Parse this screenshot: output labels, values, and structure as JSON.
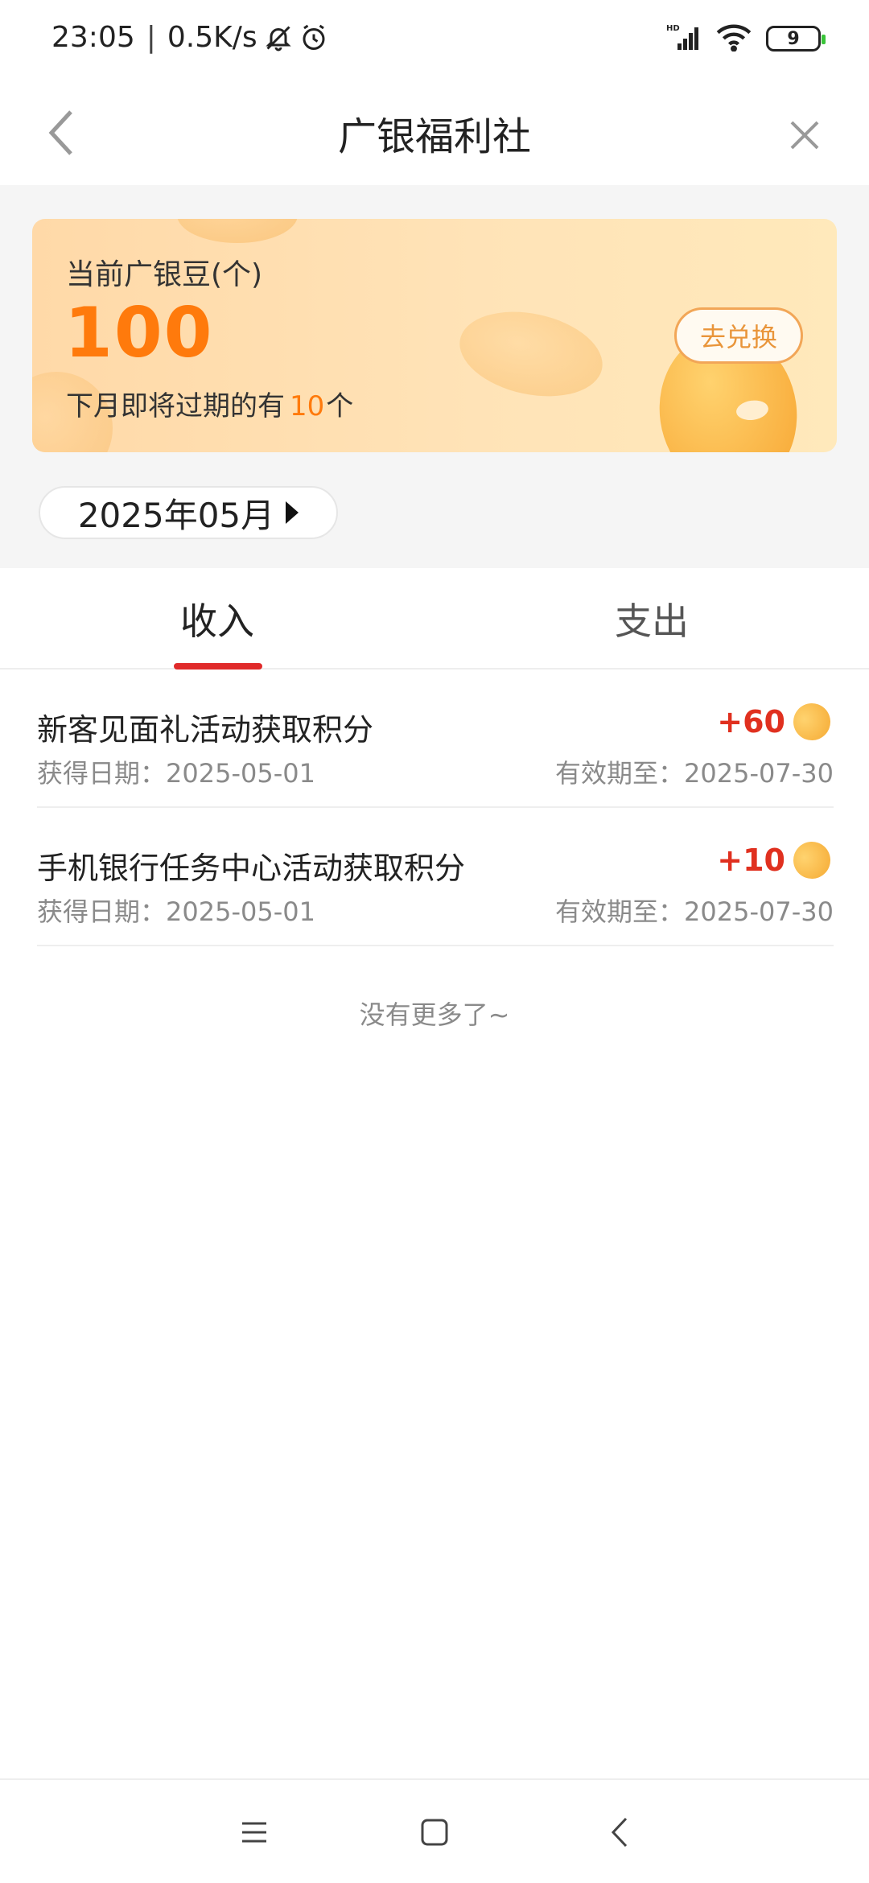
{
  "status_bar": {
    "time": "23:05",
    "separator": "|",
    "speed": "0.5K/s",
    "battery": "9"
  },
  "header": {
    "title": "广银福利社"
  },
  "card": {
    "label": "当前广银豆(个)",
    "value": "100",
    "expire_prefix": "下月即将过期的有",
    "expire_count": "10",
    "expire_suffix": "个",
    "redeem_label": "去兑换"
  },
  "month_picker": {
    "value": "2025年05月"
  },
  "tabs": [
    {
      "label": "收入",
      "active": true
    },
    {
      "label": "支出",
      "active": false
    }
  ],
  "records": [
    {
      "name": "新客见面礼活动获取积分",
      "points": "+60",
      "date": "获得日期：2025-05-01",
      "expiry": "有效期至：2025-07-30"
    },
    {
      "name": "手机银行任务中心活动获取积分",
      "points": "+10",
      "date": "获得日期：2025-05-01",
      "expiry": "有效期至：2025-07-30"
    }
  ],
  "footer_text": "没有更多了~",
  "colors": {
    "accent_orange": "#ff7a0c",
    "points_red": "#e0301f",
    "tab_underline": "#e02a2a"
  }
}
